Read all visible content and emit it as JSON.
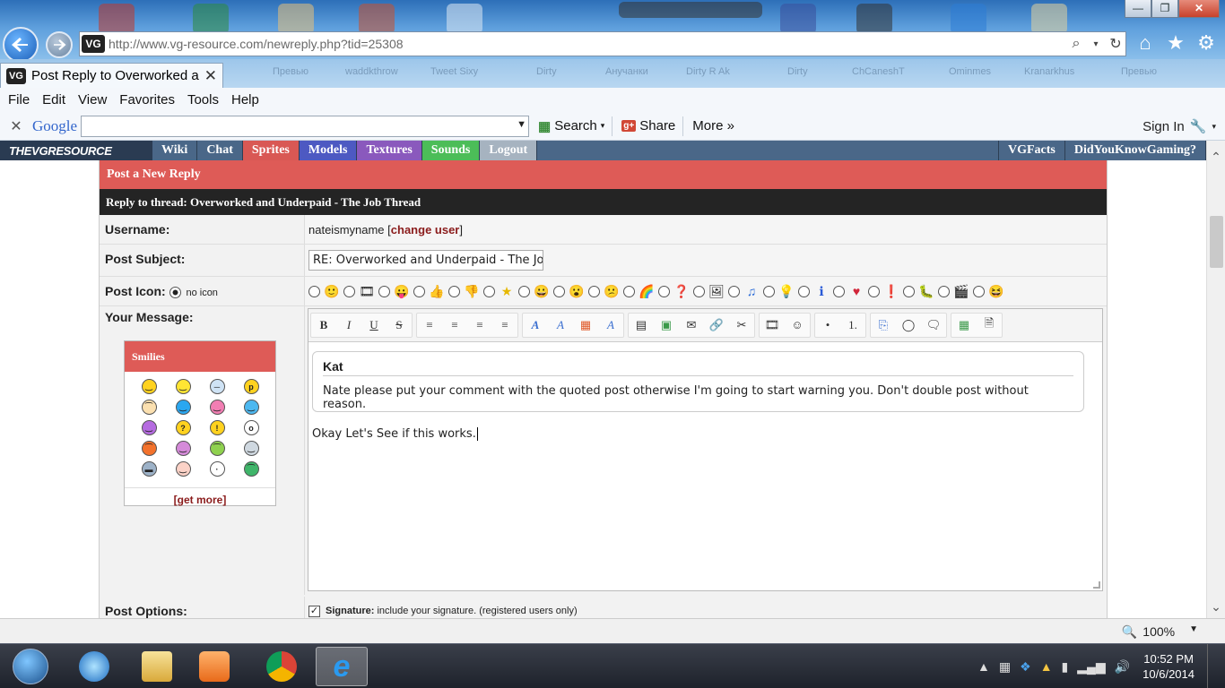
{
  "browser": {
    "url": "http://www.vg-resource.com/newreply.php?tid=25308",
    "tab_title": "Post Reply to Overworked a...",
    "favicon_label": "VG",
    "window_controls": [
      "—",
      "❐",
      "✕"
    ],
    "ghost_tabs": [
      "Превью",
      "waddkthrow",
      "Tweet Sixy",
      "Dirty",
      "Анучанки",
      "Dirty R Ak",
      "Dirty",
      "ChCaneshT",
      "Ominmes",
      "Kranarkhus",
      "Превью"
    ]
  },
  "menu": [
    "File",
    "Edit",
    "View",
    "Favorites",
    "Tools",
    "Help"
  ],
  "google_bar": {
    "logo": "Google",
    "search": "Search",
    "share": "Share",
    "more": "More »",
    "sign_in": "Sign In"
  },
  "site_nav": {
    "logo": "THEVGRESOURCE",
    "links": [
      {
        "label": "Wiki",
        "color": "#4a6788"
      },
      {
        "label": "Chat",
        "color": "#4a6788"
      },
      {
        "label": "Sprites",
        "color": "#d95854"
      },
      {
        "label": "Models",
        "color": "#4d59c2"
      },
      {
        "label": "Textures",
        "color": "#8a59bd"
      },
      {
        "label": "Sounds",
        "color": "#4cbd58"
      },
      {
        "label": "Logout",
        "color": "#a6b3c0"
      }
    ],
    "right_links": [
      "VGFacts",
      "DidYouKnowGaming?"
    ]
  },
  "form": {
    "heading": "Post a New Reply",
    "thread": "Reply to thread: Overworked and Underpaid - The Job Thread",
    "username_label": "Username:",
    "username": "nateismyname",
    "change_user": "change user",
    "subject_label": "Post Subject:",
    "subject_value": "RE: Overworked and Underpaid - The Job Tl",
    "icon_label": "Post Icon:",
    "no_icon": "no icon",
    "message_label": "Your Message:",
    "options_label": "Post Options:",
    "signature_bold": "Signature:",
    "signature_text": "include your signature. (registered users only)"
  },
  "smilies": {
    "title": "Smilies",
    "get_more": "[get more]"
  },
  "editor": {
    "quote_author": "Kat",
    "quote_text": "Nate please put your comment with the quoted post otherwise I'm going to start warning you. Don't double post without reason.",
    "message": "Okay Let's See if this works."
  },
  "status": {
    "zoom": "100%"
  },
  "taskbar": {
    "time": "10:52 PM",
    "date": "10/6/2014"
  }
}
